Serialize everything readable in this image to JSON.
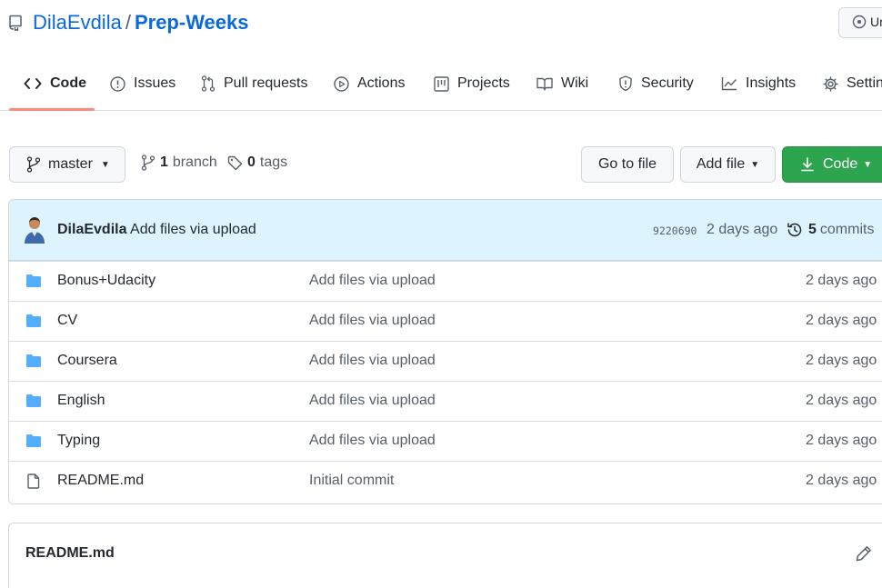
{
  "repo": {
    "owner": "DilaEvdila",
    "separator": "/",
    "name": "Prep-Weeks",
    "watch_label": "Un"
  },
  "nav": {
    "tabs": [
      {
        "label": "Code",
        "icon": "code-icon"
      },
      {
        "label": "Issues",
        "icon": "issue-icon"
      },
      {
        "label": "Pull requests",
        "icon": "pull-request-icon"
      },
      {
        "label": "Actions",
        "icon": "play-icon"
      },
      {
        "label": "Projects",
        "icon": "project-icon"
      },
      {
        "label": "Wiki",
        "icon": "book-icon"
      },
      {
        "label": "Security",
        "icon": "shield-icon"
      },
      {
        "label": "Insights",
        "icon": "graph-icon"
      },
      {
        "label": "Settin",
        "icon": "gear-icon"
      }
    ]
  },
  "toolbar": {
    "branch": "master",
    "branch_count": "1",
    "branch_label": "branch",
    "tag_count": "0",
    "tag_label": "tags",
    "go_to_file": "Go to file",
    "add_file": "Add file",
    "code": "Code"
  },
  "commit": {
    "author": "DilaEvdila",
    "message": "Add files via upload",
    "sha": "9220690",
    "time": "2 days ago",
    "count": "5",
    "count_label": "commits"
  },
  "files": [
    {
      "type": "folder",
      "name": "Bonus+Udacity",
      "message": "Add files via upload",
      "age": "2 days ago"
    },
    {
      "type": "folder",
      "name": "CV",
      "message": "Add files via upload",
      "age": "2 days ago"
    },
    {
      "type": "folder",
      "name": "Coursera",
      "message": "Add files via upload",
      "age": "2 days ago"
    },
    {
      "type": "folder",
      "name": "English",
      "message": "Add files via upload",
      "age": "2 days ago"
    },
    {
      "type": "folder",
      "name": "Typing",
      "message": "Add files via upload",
      "age": "2 days ago"
    },
    {
      "type": "file",
      "name": "README.md",
      "message": "Initial commit",
      "age": "2 days ago"
    }
  ],
  "readme": {
    "title": "README.md"
  },
  "colors": {
    "link": "#0969da",
    "folder": "#54aeff",
    "primary": "#2da44e",
    "commit_bar": "#ddf4ff",
    "active_tab": "#fd8c73"
  }
}
